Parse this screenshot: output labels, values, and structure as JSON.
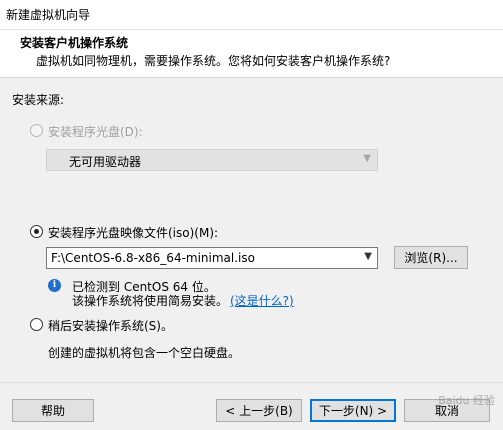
{
  "window": {
    "title": "新建虚拟机向导"
  },
  "header": {
    "title": "安装客户机操作系统",
    "subtitle": "虚拟机如同物理机，需要操作系统。您将如何安装客户机操作系统?"
  },
  "install_source": {
    "label": "安装来源:",
    "disc": {
      "label": "安装程序光盘(D):",
      "selected": false,
      "enabled": false,
      "drive_value": "无可用驱动器"
    },
    "iso": {
      "label": "安装程序光盘映像文件(iso)(M):",
      "selected": true,
      "path": "F:\\CentOS-6.8-x86_64-minimal.iso",
      "browse_label": "浏览(R)...",
      "detected": "已检测到 CentOS 64 位。",
      "easy_install": "该操作系统将使用简易安装。",
      "what_is_this": "(这是什么?)"
    },
    "later": {
      "label": "稍后安装操作系统(S)。",
      "selected": false,
      "description": "创建的虚拟机将包含一个空白硬盘。"
    }
  },
  "footer": {
    "help": "帮助",
    "back": "< 上一步(B)",
    "next": "下一步(N) >",
    "cancel": "取消"
  },
  "watermark": "Baidu 经验"
}
